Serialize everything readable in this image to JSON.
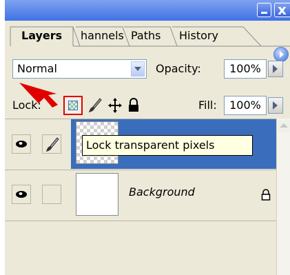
{
  "window": {
    "close_symbol": "x"
  },
  "tabs": [
    {
      "label": "Layers",
      "active": true
    },
    {
      "label": "Channels",
      "visible_text": "hannels",
      "active": false
    },
    {
      "label": "Paths",
      "visible_text": "Paths",
      "active": false
    },
    {
      "label": "History",
      "visible_text": "History",
      "active": false
    }
  ],
  "blend": {
    "mode": "Normal",
    "opacity_label": "Opacity:",
    "opacity_value": "100%"
  },
  "lock": {
    "label": "Lock:",
    "fill_label": "Fill:",
    "fill_value": "100%"
  },
  "layers": [
    {
      "name": "",
      "selected": true,
      "thumbnail": "transparent",
      "visible": true
    },
    {
      "name": "Background",
      "selected": false,
      "thumbnail": "white",
      "visible": true,
      "locked": true
    }
  ],
  "tooltip": {
    "text": "Lock transparent pixels"
  },
  "colors": {
    "selected_row": "#3a6ebd",
    "highlight": "#e00000",
    "tooltip_bg": "#ffffe1"
  },
  "icons": [
    "eye-icon",
    "brush-icon",
    "move-icon",
    "lock-icon",
    "checker-icon",
    "red-arrow"
  ]
}
